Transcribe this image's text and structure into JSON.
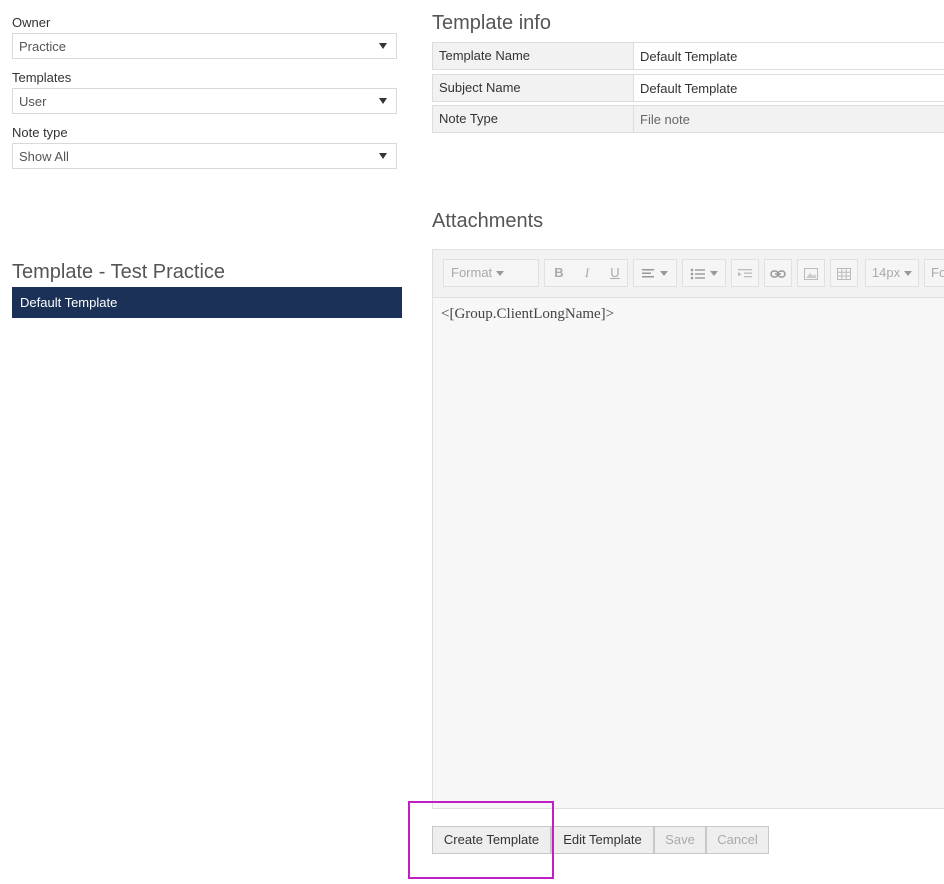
{
  "filters": {
    "owner": {
      "label": "Owner",
      "value": "Practice"
    },
    "templates": {
      "label": "Templates",
      "value": "User"
    },
    "note_type": {
      "label": "Note type",
      "value": "Show All"
    }
  },
  "template_list": {
    "title": "Template - Test Practice",
    "items": [
      {
        "label": "Default Template"
      }
    ]
  },
  "template_info": {
    "title": "Template info",
    "rows": [
      {
        "key": "Template Name",
        "value": "Default Template"
      },
      {
        "key": "Subject Name",
        "value": "Default Template"
      },
      {
        "key": "Note Type",
        "value": "File note"
      }
    ]
  },
  "attachments": {
    "title": "Attachments",
    "toolbar": {
      "format": "Format",
      "bold": "B",
      "italic": "I",
      "underline": "U",
      "font_size": "14px",
      "font_family_partial": "Fo"
    },
    "content": "<[Group.ClientLongName]>"
  },
  "actions": {
    "create": "Create Template",
    "edit": "Edit Template",
    "save": "Save",
    "cancel": "Cancel"
  },
  "colors": {
    "selected_item_bg": "#1b3158",
    "highlight_border": "#c21ec6"
  }
}
